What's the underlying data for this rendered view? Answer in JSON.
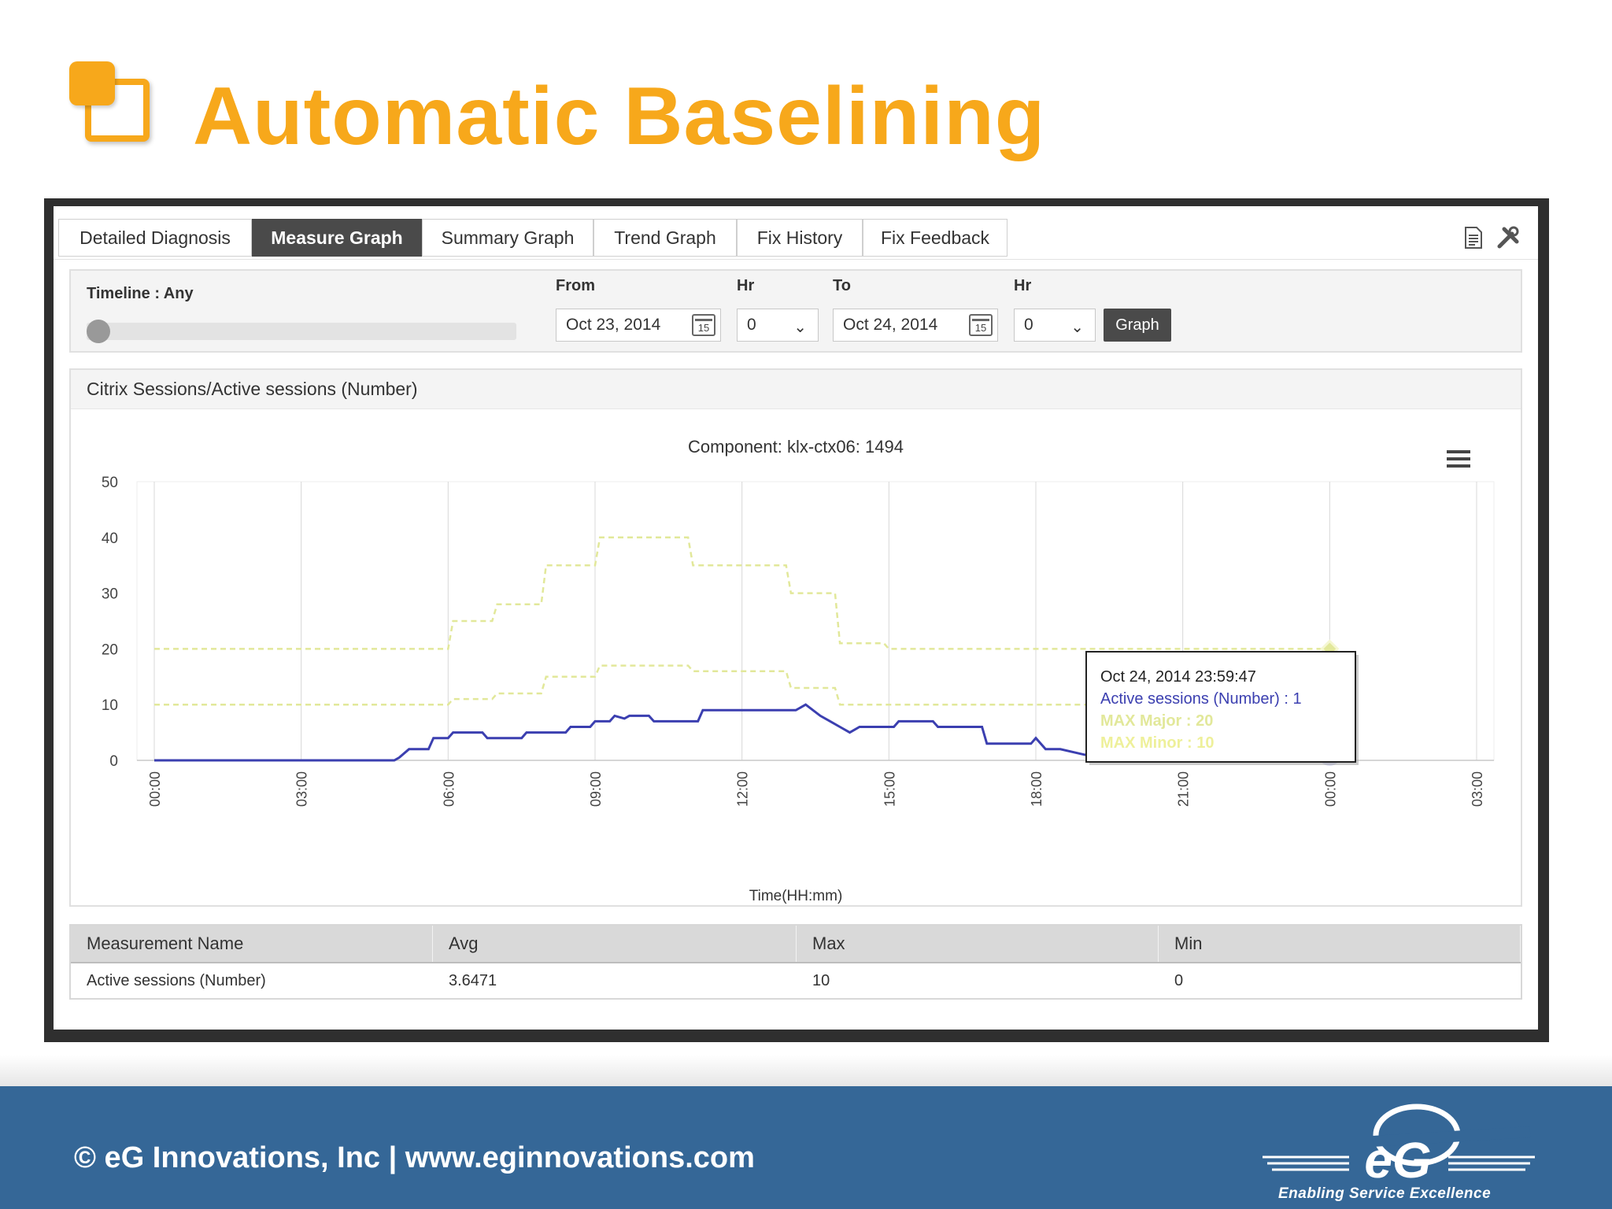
{
  "slide": {
    "title": "Automatic Baselining",
    "footer": "© eG Innovations, Inc  |  www.eginnovations.com",
    "brand_text": "eG",
    "tagline": "Enabling Service Excellence"
  },
  "tabs": [
    {
      "label": "Detailed Diagnosis",
      "active": false
    },
    {
      "label": "Measure Graph",
      "active": true
    },
    {
      "label": "Summary Graph",
      "active": false
    },
    {
      "label": "Trend Graph",
      "active": false
    },
    {
      "label": "Fix History",
      "active": false
    },
    {
      "label": "Fix Feedback",
      "active": false
    }
  ],
  "toolbar_icons": [
    "document-icon",
    "tools-icon"
  ],
  "timeline": {
    "label": "Timeline : Any",
    "from_label": "From",
    "from_date": "Oct 23, 2014",
    "hr_label": "Hr",
    "from_hr": "0",
    "to_label": "To",
    "to_date": "Oct 24, 2014",
    "to_hr_label": "Hr",
    "to_hr": "0",
    "graph_button": "Graph",
    "calendar_day": "15"
  },
  "chart_panel": {
    "heading": "Citrix Sessions/Active sessions (Number)"
  },
  "chart_data": {
    "type": "line",
    "title": "Component: klx-ctx06: 1494",
    "xlabel": "Time(HH:mm)",
    "ylabel": "",
    "ylim": [
      0,
      50
    ],
    "xlim": [
      0,
      27
    ],
    "y_ticks": [
      "0",
      "10",
      "20",
      "30",
      "40",
      "50"
    ],
    "x_ticks": [
      "00:00",
      "03:00",
      "06:00",
      "09:00",
      "12:00",
      "15:00",
      "18:00",
      "21:00",
      "00:00",
      "03:00"
    ],
    "x_tick_hours": [
      0,
      3,
      6,
      9,
      12,
      15,
      18,
      21,
      24,
      27
    ],
    "series": [
      {
        "name": "Active sessions (Number)",
        "color": "#3b3fb0",
        "style": "solid",
        "points": [
          [
            0,
            0
          ],
          [
            4.9,
            0
          ],
          [
            5,
            0.5
          ],
          [
            5.2,
            2
          ],
          [
            5.6,
            2
          ],
          [
            5.7,
            4
          ],
          [
            6,
            4
          ],
          [
            6.1,
            5
          ],
          [
            6.7,
            5
          ],
          [
            6.8,
            4
          ],
          [
            7.5,
            4
          ],
          [
            7.6,
            5
          ],
          [
            8,
            5
          ],
          [
            8.1,
            5
          ],
          [
            8.4,
            5
          ],
          [
            8.5,
            6
          ],
          [
            8.9,
            6
          ],
          [
            9,
            7
          ],
          [
            9.3,
            7
          ],
          [
            9.4,
            8
          ],
          [
            9.6,
            7.5
          ],
          [
            9.7,
            8
          ],
          [
            10.1,
            8
          ],
          [
            10.2,
            7
          ],
          [
            11.1,
            7
          ],
          [
            11.2,
            9
          ],
          [
            13.1,
            9
          ],
          [
            13.3,
            10
          ],
          [
            13.6,
            8
          ],
          [
            13.8,
            7
          ],
          [
            14,
            6
          ],
          [
            14.2,
            5
          ],
          [
            14.4,
            6
          ],
          [
            15.1,
            6
          ],
          [
            15.2,
            7
          ],
          [
            15.9,
            7
          ],
          [
            16,
            6
          ],
          [
            16.9,
            6
          ],
          [
            17,
            3
          ],
          [
            17.9,
            3
          ],
          [
            18,
            4
          ],
          [
            18.2,
            2
          ],
          [
            18.5,
            2
          ],
          [
            19,
            1
          ],
          [
            24,
            1
          ]
        ]
      },
      {
        "name": "MAX Major",
        "color": "#e2e89a",
        "style": "dashed",
        "points": [
          [
            0,
            20
          ],
          [
            6,
            20
          ],
          [
            6.1,
            25
          ],
          [
            6.9,
            25
          ],
          [
            7,
            28
          ],
          [
            7.9,
            28
          ],
          [
            8,
            35
          ],
          [
            9,
            35
          ],
          [
            9.1,
            40
          ],
          [
            10.9,
            40
          ],
          [
            11,
            35
          ],
          [
            12.9,
            35
          ],
          [
            13,
            30
          ],
          [
            13.9,
            30
          ],
          [
            14,
            21
          ],
          [
            14.9,
            21
          ],
          [
            15,
            20
          ],
          [
            24,
            20
          ]
        ]
      },
      {
        "name": "MAX Minor",
        "color": "#e2e89a",
        "style": "dashed",
        "points": [
          [
            0,
            10
          ],
          [
            6,
            10
          ],
          [
            6.1,
            11
          ],
          [
            6.9,
            11
          ],
          [
            7,
            12
          ],
          [
            7.9,
            12
          ],
          [
            8,
            15
          ],
          [
            9,
            15
          ],
          [
            9.1,
            17
          ],
          [
            10.9,
            17
          ],
          [
            11,
            16
          ],
          [
            12.9,
            16
          ],
          [
            13,
            13
          ],
          [
            13.9,
            13
          ],
          [
            14,
            10
          ],
          [
            24,
            10
          ]
        ]
      }
    ],
    "tooltip": {
      "time": "Oct 24, 2014 23:59:47",
      "line1": "Active sessions (Number) : 1",
      "line2": "MAX Major : 20",
      "line3": "MAX Minor : 10"
    }
  },
  "measurement_table": {
    "columns": [
      "Measurement Name",
      "Avg",
      "Max",
      "Min"
    ],
    "rows": [
      [
        "Active sessions (Number)",
        "3.6471",
        "10",
        "0"
      ]
    ]
  }
}
